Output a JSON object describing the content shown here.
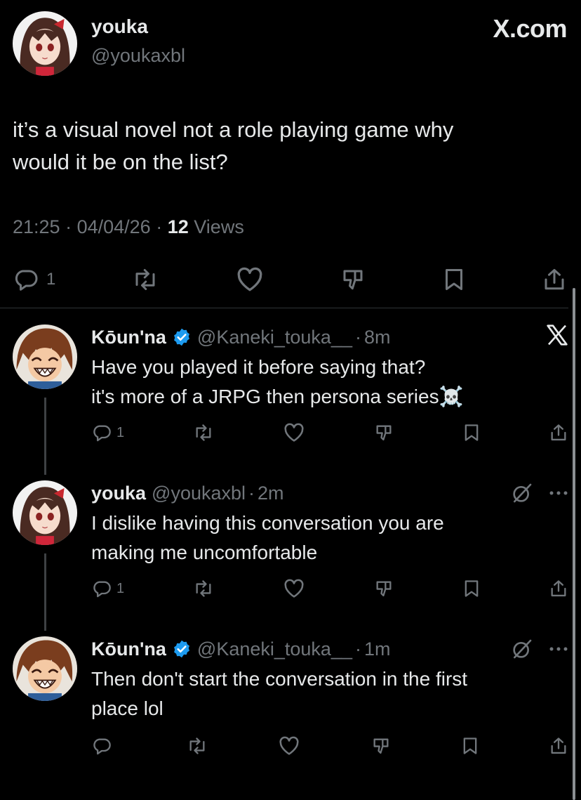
{
  "brand": "X.com",
  "main_post": {
    "display_name": "youka",
    "handle": "@youkaxbl",
    "text_lines": [
      "it’s a visual novel not a role playing game why",
      "would it be on the list?"
    ],
    "time": "21:25",
    "date": "04/04/26",
    "views_count": "12",
    "views_label": "Views",
    "reply_count": "1"
  },
  "replies": [
    {
      "display_name": "Kōun'na",
      "verified": true,
      "handle": "@Kaneki_touka__",
      "age": "8m",
      "text_lines": [
        "Have you played it before saying that?",
        "it's more of a JRPG then persona series☠️"
      ],
      "reply_count": "1",
      "corner": [
        "x-logo-icon"
      ]
    },
    {
      "display_name": "youka",
      "verified": false,
      "handle": "@youkaxbl",
      "age": "2m",
      "text_lines": [
        "I dislike having this conversation you are",
        "making me uncomfortable"
      ],
      "reply_count": "1",
      "corner": [
        "grok-icon",
        "more-icon"
      ]
    },
    {
      "display_name": "Kōun'na",
      "verified": true,
      "handle": "@Kaneki_touka__",
      "age": "1m",
      "text_lines": [
        "Then don't start the conversation in the first",
        "place lol"
      ],
      "reply_count": "",
      "corner": [
        "grok-icon",
        "more-icon"
      ]
    }
  ],
  "colors": {
    "background": "#000000",
    "text": "#e7e9ea",
    "muted": "#71767b",
    "divider": "#2f3336",
    "verified": "#1d9bf0"
  }
}
